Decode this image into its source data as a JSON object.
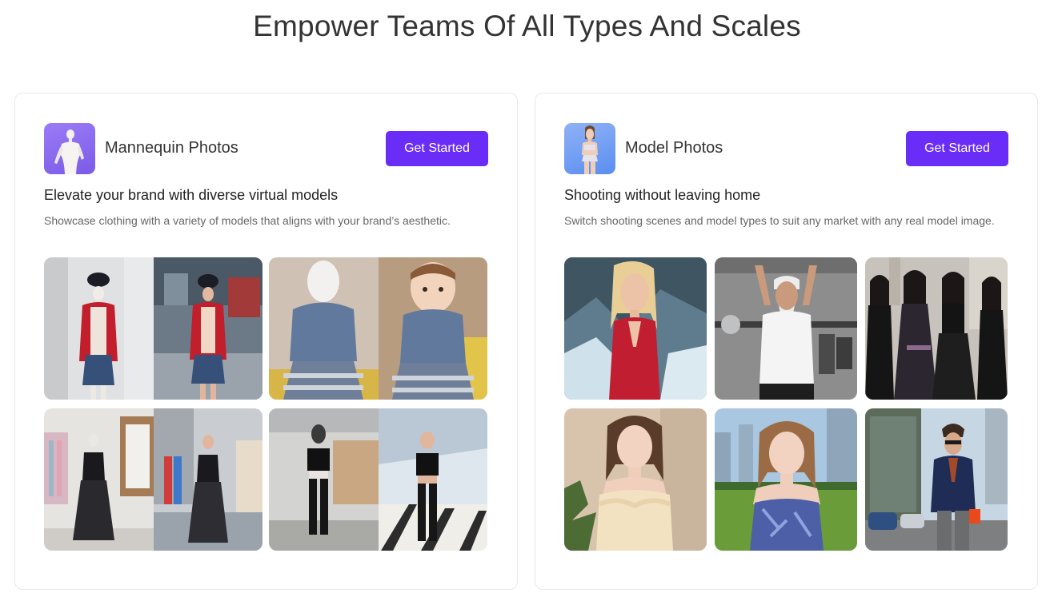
{
  "page": {
    "title": "Empower Teams Of All Types And Scales"
  },
  "cards": [
    {
      "name": "Mannequin Photos",
      "icon": "mannequin-icon",
      "button_label": "Get Started",
      "heading": "Elevate your brand with diverse virtual models",
      "description": "Showcase clothing with a variety of models that aligns with your brand’s aesthetic."
    },
    {
      "name": "Model Photos",
      "icon": "model-icon",
      "button_label": "Get Started",
      "heading": "Shooting without leaving home",
      "description": "Switch shooting scenes and model types to suit any market with any real model image."
    }
  ],
  "colors": {
    "accent": "#6a2df7",
    "card_border": "#e8e8ec",
    "title": "#333333",
    "description": "#666666"
  }
}
